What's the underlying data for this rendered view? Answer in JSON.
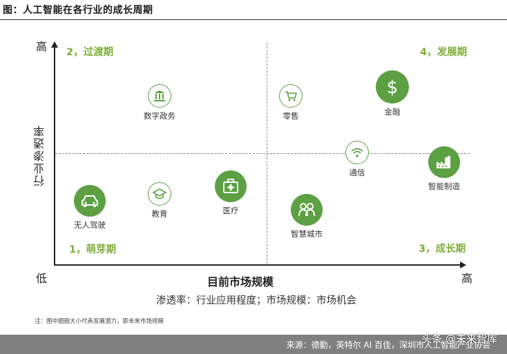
{
  "title": "图：人工智能在各行业的成长周期",
  "axes": {
    "y_label": "行业渗透率",
    "y_high": "高",
    "y_low": "低",
    "x_label": "目前市场规模",
    "x_high": "高"
  },
  "legend_note": "渗透率：行业应用程度；市场规模：市场机会",
  "quadrants": {
    "top_left": "2，过渡期",
    "top_right": "4，发展期",
    "bottom_left": "1，萌芽期",
    "bottom_right": "3，成长期"
  },
  "nodes": [
    {
      "id": "digital-gov",
      "label": "数字政务",
      "icon": "bank-icon",
      "style": "outline"
    },
    {
      "id": "retail",
      "label": "零售",
      "icon": "cart-icon",
      "style": "outline"
    },
    {
      "id": "finance",
      "label": "金融",
      "icon": "dollar-icon",
      "style": "filled"
    },
    {
      "id": "telecom",
      "label": "通信",
      "icon": "wifi-icon",
      "style": "outline"
    },
    {
      "id": "manufacturing",
      "label": "智能制造",
      "icon": "factory-icon",
      "style": "filled"
    },
    {
      "id": "autonomous",
      "label": "无人驾驶",
      "icon": "car-icon",
      "style": "filled"
    },
    {
      "id": "education",
      "label": "教育",
      "icon": "graduation-cap-icon",
      "style": "outline"
    },
    {
      "id": "healthcare",
      "label": "医疗",
      "icon": "medical-kit-icon",
      "style": "filled"
    },
    {
      "id": "smart-city",
      "label": "智慧城市",
      "icon": "people-icon",
      "style": "filled"
    }
  ],
  "colors": {
    "accent": "#5ca043",
    "quadrant_text": "#7fae3b"
  },
  "footnote": "注：图中圆圈大小代表发展潜力，即未来市场规模",
  "source": "来源：德勤，英特尔 AI 百佳，深圳市人工智能产业协会",
  "watermark": "头条 @未来智库"
}
